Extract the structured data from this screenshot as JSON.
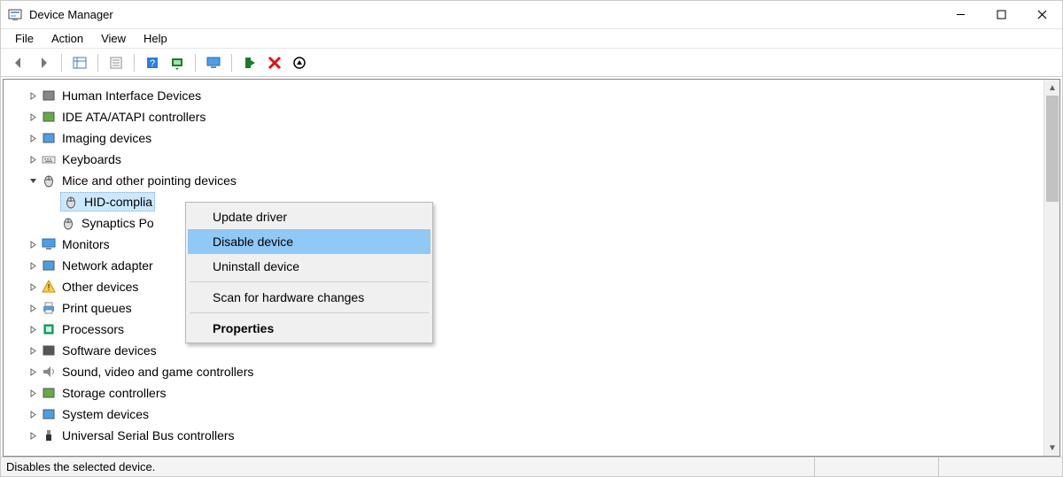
{
  "window": {
    "title": "Device Manager"
  },
  "menu": {
    "items": [
      "File",
      "Action",
      "View",
      "Help"
    ]
  },
  "toolbar": {
    "icons": [
      "back-arrow-icon",
      "forward-arrow-icon",
      "show-hidden-icon",
      "properties-icon",
      "help-icon",
      "scan-icon",
      "monitor-icon",
      "enable-icon",
      "disable-x-icon",
      "power-icon"
    ]
  },
  "tree": [
    {
      "name": "Human Interface Devices",
      "expanded": false,
      "icon": "hid-icon",
      "depth": 0
    },
    {
      "name": "IDE ATA/ATAPI controllers",
      "expanded": false,
      "icon": "ide-icon",
      "depth": 0
    },
    {
      "name": "Imaging devices",
      "expanded": false,
      "icon": "imaging-icon",
      "depth": 0
    },
    {
      "name": "Keyboards",
      "expanded": false,
      "icon": "keyboard-icon",
      "depth": 0
    },
    {
      "name": "Mice and other pointing devices",
      "expanded": true,
      "icon": "mouse-icon",
      "depth": 0
    },
    {
      "name": "HID-compliant mouse",
      "icon": "mouse-icon",
      "depth": 1,
      "selected": true,
      "truncated": "HID-complia"
    },
    {
      "name": "Synaptics Pointing Device",
      "icon": "mouse-icon",
      "depth": 1,
      "truncated": "Synaptics Po"
    },
    {
      "name": "Monitors",
      "expanded": false,
      "icon": "monitor-icon",
      "depth": 0
    },
    {
      "name": "Network adapters",
      "expanded": false,
      "icon": "network-icon",
      "depth": 0,
      "truncated": "Network adapter"
    },
    {
      "name": "Other devices",
      "expanded": false,
      "icon": "other-icon",
      "depth": 0
    },
    {
      "name": "Print queues",
      "expanded": false,
      "icon": "printer-icon",
      "depth": 0
    },
    {
      "name": "Processors",
      "expanded": false,
      "icon": "cpu-icon",
      "depth": 0
    },
    {
      "name": "Software devices",
      "expanded": false,
      "icon": "software-icon",
      "depth": 0
    },
    {
      "name": "Sound, video and game controllers",
      "expanded": false,
      "icon": "sound-icon",
      "depth": 0
    },
    {
      "name": "Storage controllers",
      "expanded": false,
      "icon": "storage-icon",
      "depth": 0
    },
    {
      "name": "System devices",
      "expanded": false,
      "icon": "system-icon",
      "depth": 0
    },
    {
      "name": "Universal Serial Bus controllers",
      "expanded": false,
      "icon": "usb-icon",
      "depth": 0
    }
  ],
  "context_menu": {
    "items": [
      {
        "label": "Update driver",
        "highlight": false
      },
      {
        "label": "Disable device",
        "highlight": true
      },
      {
        "label": "Uninstall device",
        "highlight": false
      },
      {
        "sep": true
      },
      {
        "label": "Scan for hardware changes",
        "highlight": false
      },
      {
        "sep": true
      },
      {
        "label": "Properties",
        "highlight": false,
        "bold": true
      }
    ]
  },
  "status": {
    "text": "Disables the selected device."
  }
}
